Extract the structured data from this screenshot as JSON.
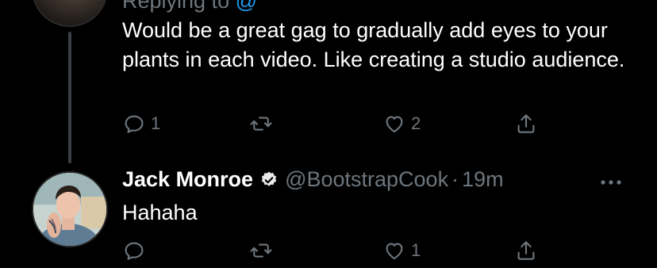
{
  "reply_1": {
    "cutoff_prefix": "Replying to",
    "cutoff_link": "@",
    "text": "Would be a great gag to gradually add eyes to your plants in each video. Like creating a studio audience.",
    "actions": {
      "reply_count": "1",
      "retweet_count": "",
      "like_count": "2"
    }
  },
  "reply_2": {
    "display_name": "Jack Monroe",
    "handle": "@BootstrapCook",
    "separator": "·",
    "time": "19m",
    "text": "Hahaha",
    "actions": {
      "reply_count": "",
      "retweet_count": "",
      "like_count": "1"
    }
  },
  "icons": {
    "reply": "reply-icon",
    "retweet": "retweet-icon",
    "like": "heart-icon",
    "share": "share-icon",
    "verified": "verified-icon",
    "more": "more-icon"
  },
  "colors": {
    "background": "#000000",
    "text": "#ffffff",
    "muted": "#6e767d",
    "thread_line": "#3b3f43",
    "link": "#1d9bf0"
  }
}
